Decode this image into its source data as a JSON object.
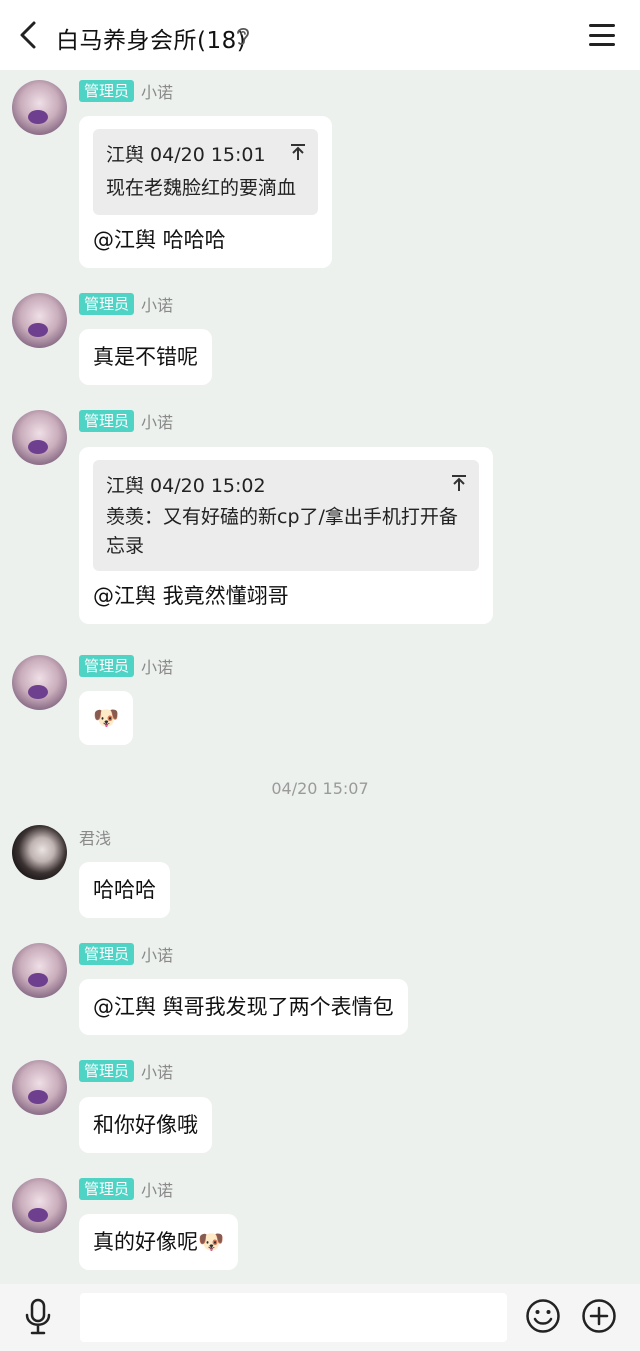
{
  "header": {
    "title": "白马养身会所(18)"
  },
  "messages": {
    "m1": {
      "badge": "管理员",
      "nick": "小诺",
      "quote_head": "江舆 04/20 15:01",
      "quote_text": "现在老魏脸红的要滴血",
      "text": "@江舆 哈哈哈"
    },
    "m2": {
      "badge": "管理员",
      "nick": "小诺",
      "text": "真是不错呢"
    },
    "m3": {
      "badge": "管理员",
      "nick": "小诺",
      "quote_head": "江舆 04/20 15:02",
      "quote_text": "羡羡：又有好磕的新cp了/拿出手机打开备忘录",
      "text": "@江舆 我竟然懂翊哥"
    },
    "m4": {
      "badge": "管理员",
      "nick": "小诺",
      "text": "🐶"
    },
    "timestamp": "04/20 15:07",
    "m5": {
      "nick": "君浅",
      "text": "哈哈哈"
    },
    "m6": {
      "badge": "管理员",
      "nick": "小诺",
      "text": "@江舆 舆哥我发现了两个表情包"
    },
    "m7": {
      "badge": "管理员",
      "nick": "小诺",
      "text": "和你好像哦"
    },
    "m8": {
      "badge": "管理员",
      "nick": "小诺",
      "text": "真的好像呢🐶"
    }
  },
  "colors": {
    "badge": "#4fd3c5",
    "background": "#edf1ee",
    "bubble": "#ffffff"
  }
}
